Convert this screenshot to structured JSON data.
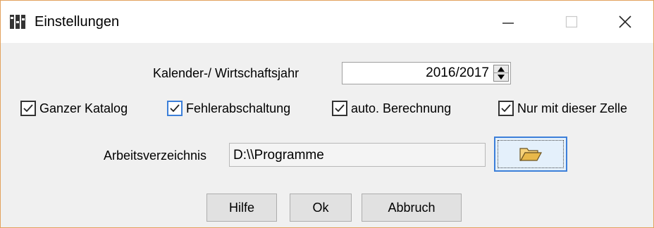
{
  "window": {
    "title": "Einstellungen",
    "controls": {
      "minimize": "—",
      "maximize": "☐",
      "close": "✕"
    }
  },
  "year": {
    "label": "Kalender-/ Wirtschaftsjahr",
    "value": "2016/2017",
    "spin_up_icon": "triangle-up-icon",
    "spin_down_icon": "triangle-down-icon"
  },
  "options": [
    {
      "label": "Ganzer Katalog",
      "checked": true
    },
    {
      "label": "Fehlerabschaltung",
      "checked": true,
      "focused": true
    },
    {
      "label": "auto. Berechnung",
      "checked": true
    },
    {
      "label": "Nur mit dieser Zelle",
      "checked": true
    }
  ],
  "workdir": {
    "label": "Arbeitsverzeichnis",
    "value": "D:\\\\Programme",
    "browse_icon": "open-folder-icon"
  },
  "buttons": {
    "help": "Hilfe",
    "ok": "Ok",
    "cancel": "Abbruch"
  },
  "colors": {
    "accent": "#3c7fd9",
    "window_border": "#e3a25e",
    "dialog_bg": "#f0f0f0",
    "folder_icon": "#e8b84a"
  }
}
